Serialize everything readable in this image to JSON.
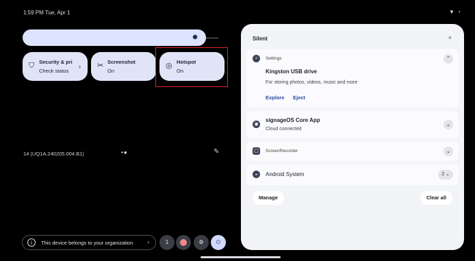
{
  "status_bar": {
    "time": "1:59 PM  Tue, Apr 1",
    "icons": "wifi-icon, hotspot-icon"
  },
  "quick_settings": {
    "tiles": [
      {
        "title": "Security & pri",
        "subtitle": "Check status",
        "icon": "shield-icon",
        "has_chevron": true
      },
      {
        "title": "Screenshot",
        "subtitle": "On",
        "icon": "scissors-icon"
      },
      {
        "title": "Hotspot",
        "subtitle": "On",
        "icon": "hotspot-icon"
      }
    ],
    "build": "14 (UQ1A.240205.004.B1)"
  },
  "bottom_bar": {
    "org_text": "This device belongs to your organization",
    "user_count": "1"
  },
  "notifications": {
    "header": "Silent",
    "close_label": "×",
    "items": [
      {
        "app": "Settings",
        "title": "Kingston USB drive",
        "text": "For storing photos, videos, music and more",
        "actions": [
          "Explore",
          "Eject"
        ]
      },
      {
        "title": "signageOS Core App",
        "text": "Cloud connected"
      },
      {
        "app": "ScreenRecorder"
      },
      {
        "title": "Android System",
        "count": "2"
      }
    ],
    "manage_label": "Manage",
    "clear_label": "Clear all"
  },
  "colors": {
    "accent": "#dfe4f7",
    "highlight": "#e0262b",
    "panel": "#f3f4f8"
  }
}
